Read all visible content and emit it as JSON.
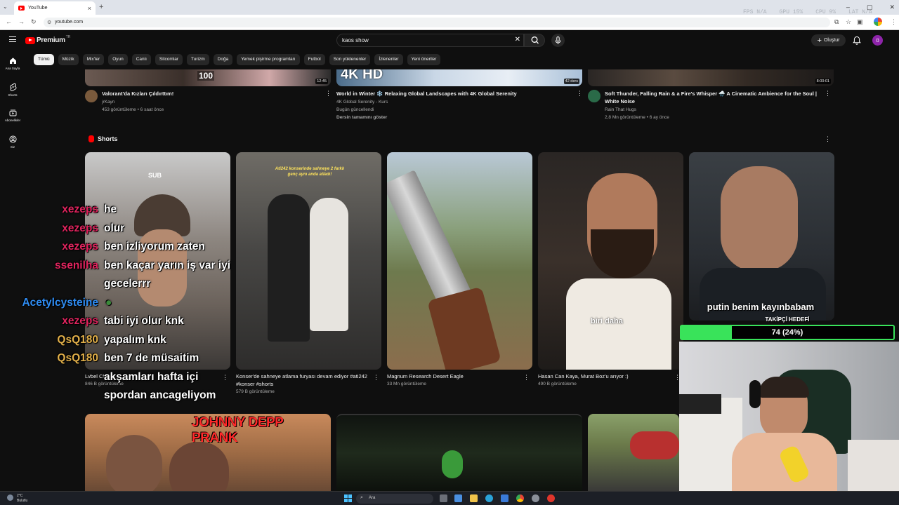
{
  "browser": {
    "tab_title": "YouTube",
    "url": "youtube.com",
    "overlay_stats": [
      "FPS N/A",
      "GPU 15%",
      "CPU 9%",
      "LAT N/A"
    ]
  },
  "header": {
    "logo_text": "Premium",
    "logo_region": "TR",
    "search_query": "kaos show",
    "create_label": "Oluştur",
    "avatar_letter": "ö"
  },
  "sidebar": {
    "items": [
      {
        "label": "Ana Sayfa",
        "icon": "home-icon"
      },
      {
        "label": "Shorts",
        "icon": "shorts-icon"
      },
      {
        "label": "Abonelikler",
        "icon": "subscriptions-icon"
      },
      {
        "label": "Siz",
        "icon": "you-icon"
      }
    ]
  },
  "chips": [
    "Tümü",
    "Müzik",
    "Mix'ler",
    "Oyun",
    "Canlı",
    "Sitcomlar",
    "Turizm",
    "Doğa",
    "Yemek pişirme programları",
    "Futbol",
    "Son yüklenenler",
    "İzlenenler",
    "Yeni öneriler"
  ],
  "top_videos": [
    {
      "title": "Valorant'da Kızları Çıldırttım!",
      "channel": "jrKayn",
      "meta": "453 görüntüleme • 6 saat önce",
      "extra": "",
      "duration": "12:45",
      "badge": "100"
    },
    {
      "title": "World in Winter ❄️ Relaxing Global Landscapes with 4K Global Serenity",
      "channel": "4K Global Serenity - Kurs",
      "meta": "Bugün güncellendi",
      "extra": "Dersin tamamını göster",
      "duration": "42 ders",
      "badge": "4K HD"
    },
    {
      "title": "Soft Thunder, Falling Rain & a Fire's Whisper 🌧️ A Cinematic Ambience for the Soul | White Noise",
      "channel": "Rain That Hugs",
      "meta": "2,8 Mn görüntüleme • 6 ay önce",
      "extra": "",
      "duration": "8:00:01",
      "badge": ""
    }
  ],
  "shorts": {
    "section_title": "Shorts",
    "items": [
      {
        "title": "Lvbel C5 - ...",
        "views": "846 B görüntüleme",
        "overlay": "SUB"
      },
      {
        "title": "Konser'de sahneye atlama furyası devam ediyor #ati242 #konser #shorts",
        "views": "579 B görüntüleme",
        "overlay": "Ati242 konserinde sahneye 2 farklı genç aynı anda atladı!"
      },
      {
        "title": "Magnum Research Desert Eagle",
        "views": "33 Mn görüntüleme",
        "overlay": ""
      },
      {
        "title": "Hasan Can Kaya, Murat Boz'u arıyor :)",
        "views": "490 B görüntüleme",
        "overlay": "biri daha"
      },
      {
        "title": "",
        "views": "",
        "overlay": "putin benim kayınbabam"
      }
    ]
  },
  "bottom_videos": [
    {
      "overlay": "JOHNNY DEPP PRANK"
    },
    {
      "overlay": ""
    },
    {
      "overlay": ""
    }
  ],
  "chat": [
    {
      "user": "xezeps",
      "msg": "he",
      "color": "#e0245e"
    },
    {
      "user": "xezeps",
      "msg": "olur",
      "color": "#e0245e"
    },
    {
      "user": "xezeps",
      "msg": "ben izliyorum zaten",
      "color": "#e0245e"
    },
    {
      "user": "ssenilha",
      "msg": "ben kaçar yarın iş var iyi",
      "color": "#e0245e"
    },
    {
      "user": "",
      "msg": "gecelerrr",
      "color": "#e0245e"
    },
    {
      "user": "Acetylcysteine",
      "msg": "",
      "color": "#2f8cf2"
    },
    {
      "user": "xezeps",
      "msg": "tabi iyi olur knk",
      "color": "#e0245e"
    },
    {
      "user": "QsQ180",
      "msg": "yapalım knk",
      "color": "#e2b04a"
    },
    {
      "user": "QsQ180",
      "msg": "ben 7 de müsaitim",
      "color": "#e2b04a"
    },
    {
      "user": "",
      "msg": "akşamları hafta içi",
      "color": "#e2b04a"
    },
    {
      "user": "",
      "msg": "spordan ancageliyom",
      "color": "#e2b04a"
    }
  ],
  "follower_goal": {
    "label": "TAKİPÇİ HEDEFİ",
    "text": "74 (24%)",
    "fraction": 0.24
  },
  "taskbar": {
    "weather_temp": "2°C",
    "weather_desc": "Bulutlu",
    "search_placeholder": "Ara"
  },
  "colors": {
    "accent": "#ff0000",
    "goal": "#39e35a"
  }
}
